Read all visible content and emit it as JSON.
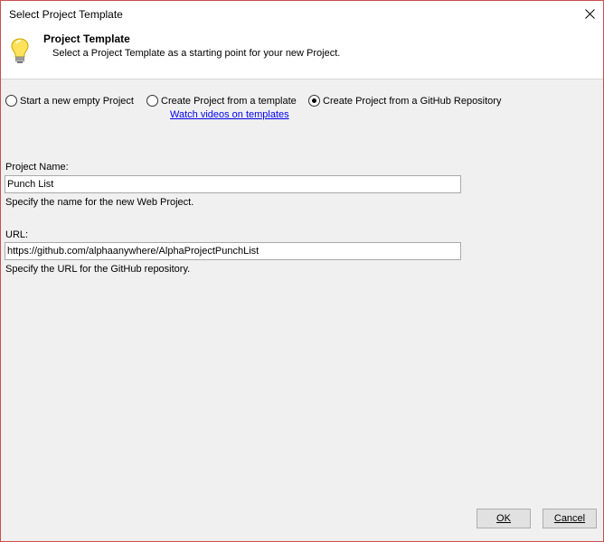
{
  "window": {
    "title": "Select Project Template"
  },
  "header": {
    "title": "Project Template",
    "description": "Select a Project Template as a starting point for your new Project."
  },
  "options": [
    {
      "label": "Start a new empty Project",
      "checked": false
    },
    {
      "label": "Create Project from a template",
      "checked": false
    },
    {
      "label": "Create Project from a GitHub Repository",
      "checked": true
    }
  ],
  "link": {
    "label": "Watch videos on templates"
  },
  "project_name": {
    "label": "Project Name:",
    "value": "Punch List",
    "hint": "Specify the name for the new Web Project."
  },
  "url": {
    "label": "URL:",
    "value": "https://github.com/alphaanywhere/AlphaProjectPunchList",
    "hint": "Specify the URL for the GitHub repository."
  },
  "buttons": {
    "ok_label": "OK",
    "cancel_label": "Cancel"
  },
  "colors": {
    "window_border": "#c75050",
    "link": "#0000ee",
    "dialog_background": "#f0f0f0"
  }
}
